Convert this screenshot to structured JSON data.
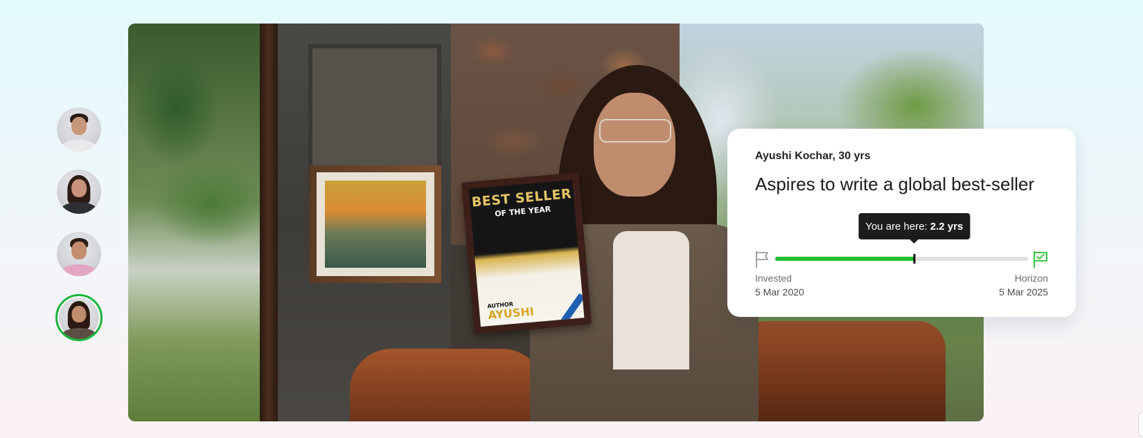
{
  "avatars": [
    {
      "icon": "male-avatar-icon",
      "shirt_color": "#e9e9ea",
      "skin": "#c7977a",
      "long_hair": false,
      "active": false
    },
    {
      "icon": "female-avatar-icon",
      "shirt_color": "#2f2f33",
      "skin": "#c8937a",
      "long_hair": true,
      "active": false
    },
    {
      "icon": "male-avatar-icon",
      "shirt_color": "#e4a7c3",
      "skin": "#c28e6e",
      "long_hair": false,
      "active": false
    },
    {
      "icon": "female-avatar-icon",
      "shirt_color": "#5b4f43",
      "skin": "#c08c6e",
      "long_hair": true,
      "active": true
    }
  ],
  "hero": {
    "award_title": "BEST SELLER",
    "award_subtitle": "OF THE YEAR",
    "award_author_label": "AUTHOR",
    "award_author_name": "AYUSHI"
  },
  "card": {
    "person": "Ayushi Kochar, 30 yrs",
    "goal": "Aspires to write a global best-seller",
    "tooltip_prefix": "You are here:",
    "tooltip_value": "2.2 yrs",
    "progress_fraction": 0.55,
    "start_label": "Invested",
    "start_date": "5 Mar 2020",
    "end_label": "Horizon",
    "end_date": "5 Mar 2025",
    "start_flag_icon": "flag-icon",
    "end_flag_icon": "flag-check-icon",
    "accent_color": "#1ec12d"
  }
}
